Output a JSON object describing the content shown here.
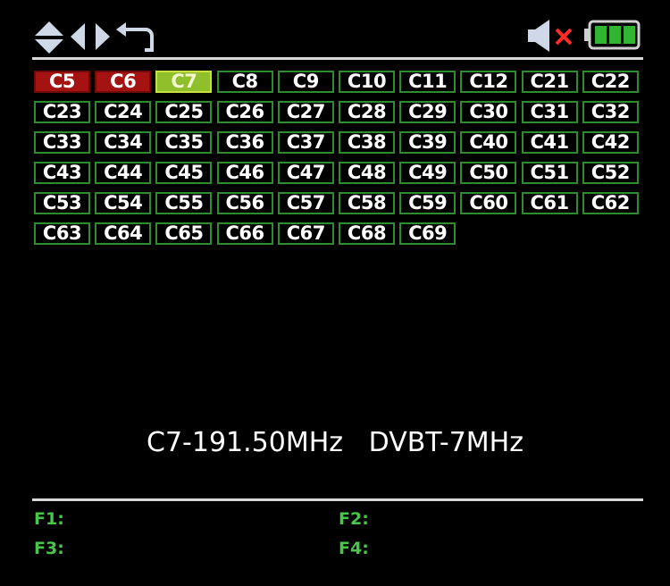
{
  "toolbar": {
    "icons": [
      "up-down-arrows-icon",
      "left-arrow-icon",
      "right-arrow-icon",
      "return-icon",
      "speaker-muted-icon",
      "battery-full-icon"
    ]
  },
  "colors": {
    "red": "#a51212",
    "selected": "#8fbf2a",
    "border": "#2e8b2e",
    "fkey": "#49c64a"
  },
  "channels": [
    {
      "label": "C5",
      "state": "red"
    },
    {
      "label": "C6",
      "state": "red"
    },
    {
      "label": "C7",
      "state": "selected"
    },
    {
      "label": "C8",
      "state": "normal"
    },
    {
      "label": "C9",
      "state": "normal"
    },
    {
      "label": "C10",
      "state": "normal"
    },
    {
      "label": "C11",
      "state": "normal"
    },
    {
      "label": "C12",
      "state": "normal"
    },
    {
      "label": "C21",
      "state": "normal"
    },
    {
      "label": "C22",
      "state": "normal"
    },
    {
      "label": "C23",
      "state": "normal"
    },
    {
      "label": "C24",
      "state": "normal"
    },
    {
      "label": "C25",
      "state": "normal"
    },
    {
      "label": "C26",
      "state": "normal"
    },
    {
      "label": "C27",
      "state": "normal"
    },
    {
      "label": "C28",
      "state": "normal"
    },
    {
      "label": "C29",
      "state": "normal"
    },
    {
      "label": "C30",
      "state": "normal"
    },
    {
      "label": "C31",
      "state": "normal"
    },
    {
      "label": "C32",
      "state": "normal"
    },
    {
      "label": "C33",
      "state": "normal"
    },
    {
      "label": "C34",
      "state": "normal"
    },
    {
      "label": "C35",
      "state": "normal"
    },
    {
      "label": "C36",
      "state": "normal"
    },
    {
      "label": "C37",
      "state": "normal"
    },
    {
      "label": "C38",
      "state": "normal"
    },
    {
      "label": "C39",
      "state": "normal"
    },
    {
      "label": "C40",
      "state": "normal"
    },
    {
      "label": "C41",
      "state": "normal"
    },
    {
      "label": "C42",
      "state": "normal"
    },
    {
      "label": "C43",
      "state": "normal"
    },
    {
      "label": "C44",
      "state": "normal"
    },
    {
      "label": "C45",
      "state": "normal"
    },
    {
      "label": "C46",
      "state": "normal"
    },
    {
      "label": "C47",
      "state": "normal"
    },
    {
      "label": "C48",
      "state": "normal"
    },
    {
      "label": "C49",
      "state": "normal"
    },
    {
      "label": "C50",
      "state": "normal"
    },
    {
      "label": "C51",
      "state": "normal"
    },
    {
      "label": "C52",
      "state": "normal"
    },
    {
      "label": "C53",
      "state": "normal"
    },
    {
      "label": "C54",
      "state": "normal"
    },
    {
      "label": "C55",
      "state": "normal"
    },
    {
      "label": "C56",
      "state": "normal"
    },
    {
      "label": "C57",
      "state": "normal"
    },
    {
      "label": "C58",
      "state": "normal"
    },
    {
      "label": "C59",
      "state": "normal"
    },
    {
      "label": "C60",
      "state": "normal"
    },
    {
      "label": "C61",
      "state": "normal"
    },
    {
      "label": "C62",
      "state": "normal"
    },
    {
      "label": "C63",
      "state": "normal"
    },
    {
      "label": "C64",
      "state": "normal"
    },
    {
      "label": "C65",
      "state": "normal"
    },
    {
      "label": "C66",
      "state": "normal"
    },
    {
      "label": "C67",
      "state": "normal"
    },
    {
      "label": "C68",
      "state": "normal"
    },
    {
      "label": "C69",
      "state": "normal"
    }
  ],
  "status": {
    "text": "C7-191.50MHz   DVBT-7MHz"
  },
  "function_keys": {
    "f1": "F1:",
    "f2": "F2:",
    "f3": "F3:",
    "f4": "F4:"
  }
}
